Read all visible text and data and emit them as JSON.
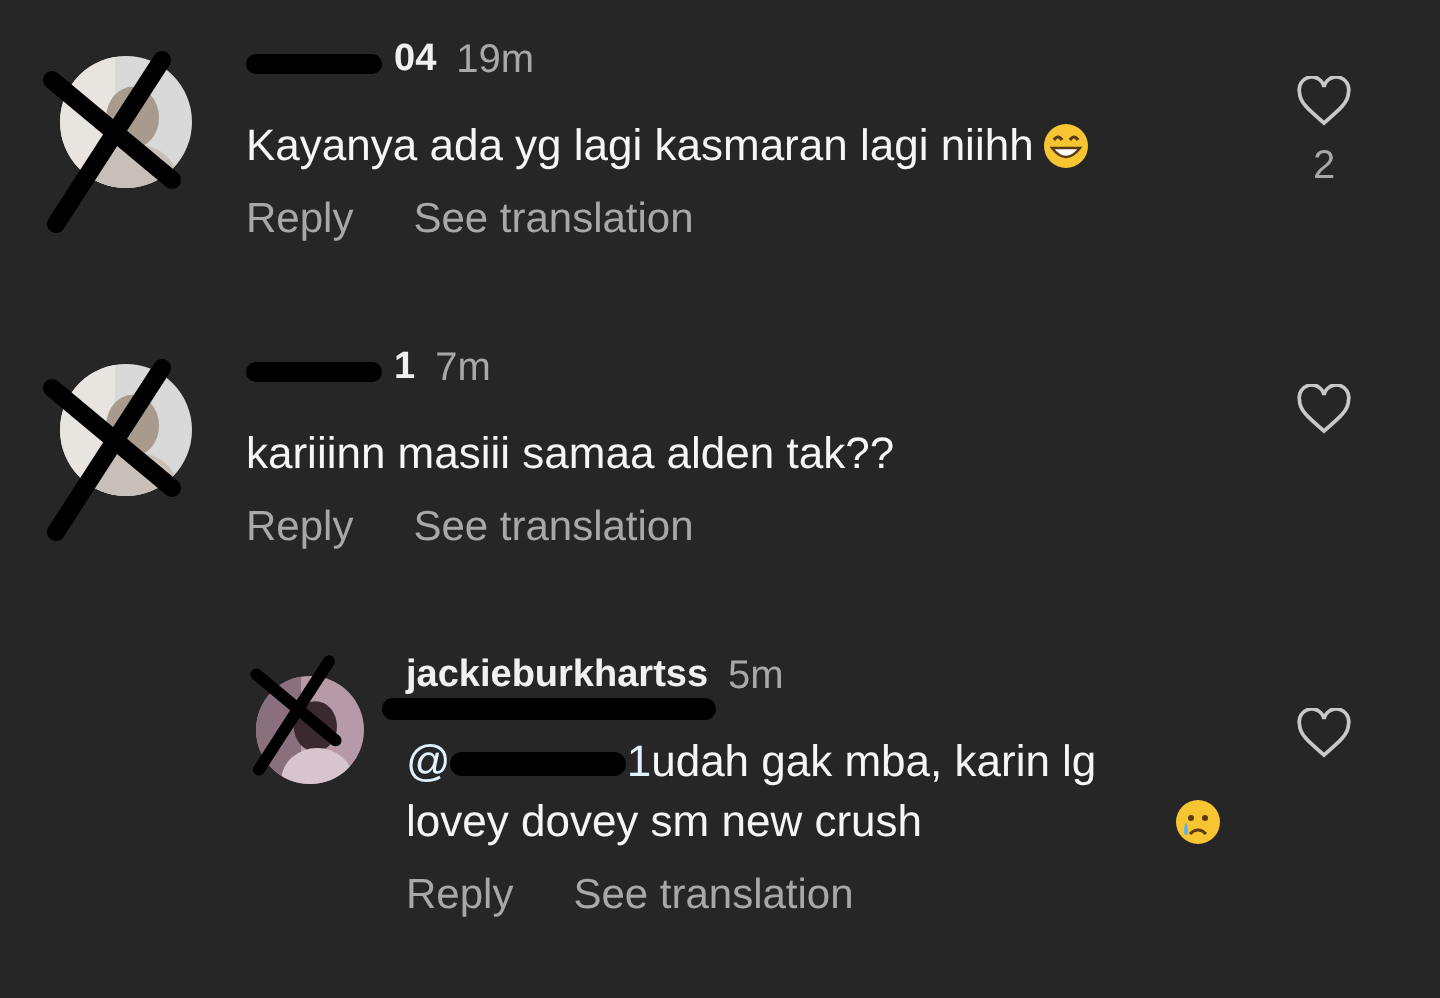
{
  "comments": [
    {
      "username": "04",
      "time": "19m",
      "text": "Kayanya ada yg lagi kasmaran lagi niihh",
      "emoji": {
        "kind": "grin"
      },
      "reply": "Reply",
      "translate": "See translation",
      "liked": false,
      "likes": "2"
    },
    {
      "username": "1",
      "time": "7m",
      "text": "kariiinn masiii samaa alden tak??",
      "reply": "Reply",
      "translate": "See translation",
      "liked": false,
      "children": [
        {
          "username": "jackieburkhartss",
          "time": "5m",
          "mention": {
            "head": "@",
            "tail": "1"
          },
          "text": "udah gak mba, karin lg lovey dovey sm new crush",
          "emoji": {
            "kind": "tear"
          },
          "reply": "Reply",
          "translate": "See translation",
          "liked": false
        }
      ]
    }
  ]
}
